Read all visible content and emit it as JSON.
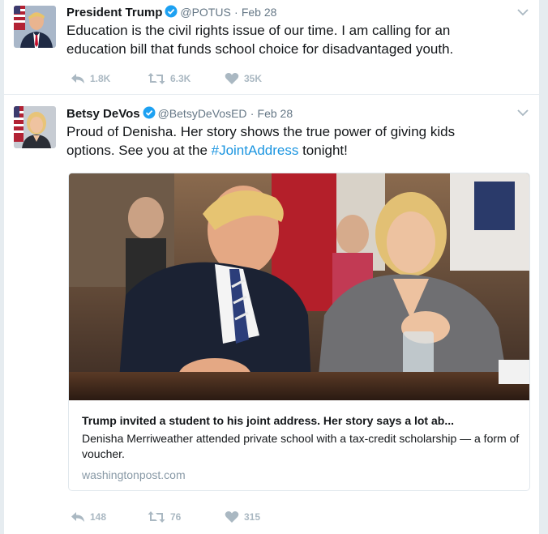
{
  "tweets": [
    {
      "name": "President Trump",
      "handle": "@POTUS",
      "separator": "·",
      "date": "Feb 28",
      "text": "Education is the civil rights issue of our time. I am calling for an education bill that funds school choice for disadvantaged youth.",
      "replies": "1.8K",
      "retweets": "6.3K",
      "likes": "35K"
    },
    {
      "name": "Betsy DeVos",
      "handle": "@BetsyDeVosED",
      "separator": "·",
      "date": "Feb 28",
      "text_before": "Proud of Denisha. Her story shows the true power of giving kids options. See you at the ",
      "hashtag": "#JointAddress",
      "text_after": " tonight!",
      "card": {
        "title": "Trump invited a student to his joint address. Her story says a lot ab...",
        "description": "Denisha Merriweather attended private school with a tax-credit scholarship — a form of voucher.",
        "domain": "washingtonpost.com"
      },
      "replies": "148",
      "retweets": "76",
      "likes": "315"
    }
  ],
  "icons": {
    "verified": "verified-badge-icon",
    "chevron": "chevron-down-icon",
    "reply": "reply-icon",
    "retweet": "retweet-icon",
    "like": "heart-icon"
  },
  "colors": {
    "link": "#1b95e0",
    "verified": "#1da1f2",
    "muted": "#657786",
    "action": "#aab8c2",
    "border": "#e6ecf0"
  }
}
